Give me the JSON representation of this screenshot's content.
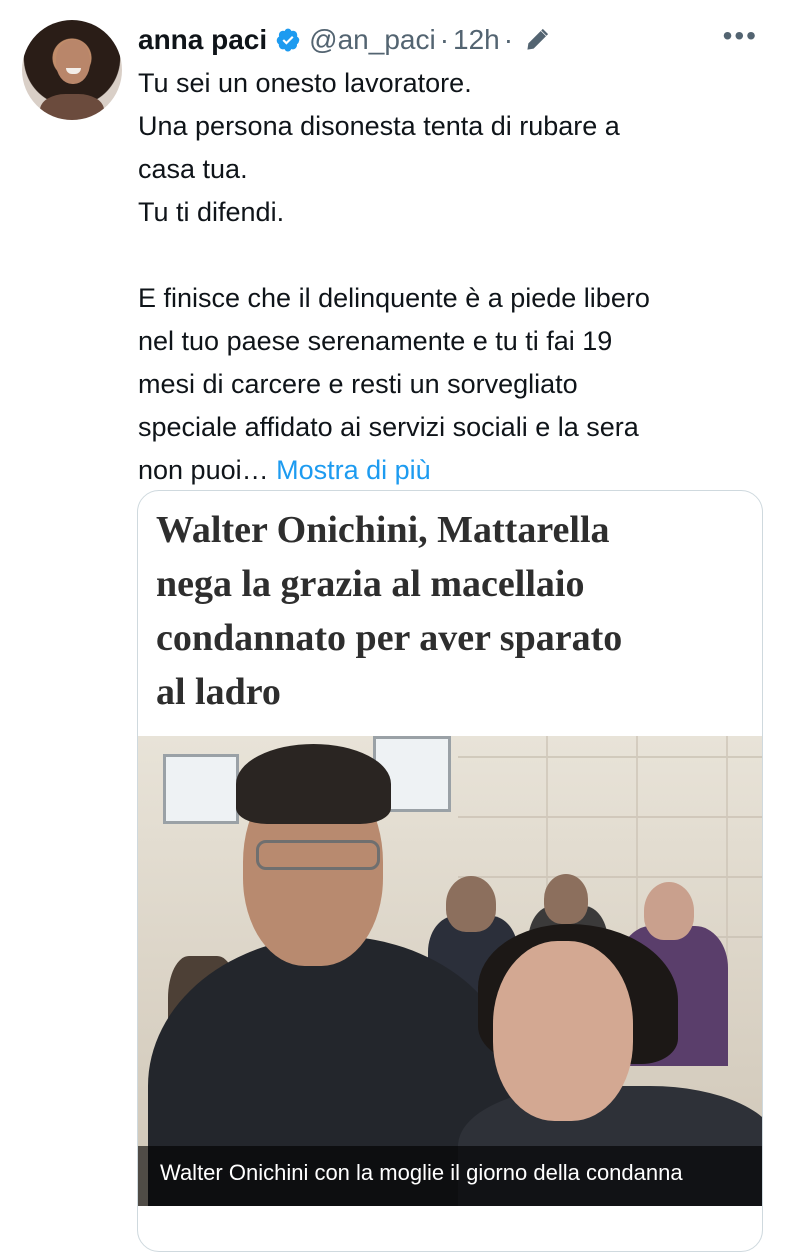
{
  "tweet": {
    "author_name": "anna paci",
    "handle": "@an_paci",
    "separator": "·",
    "time": "12h",
    "icons": {
      "avatar": "profile-photo",
      "verified": "verified-badge-icon",
      "edit": "pen-icon",
      "more": "more-icon"
    },
    "text_lines": [
      "Tu sei un onesto lavoratore.",
      "Una persona disonesta tenta di rubare a",
      "casa tua.",
      "Tu ti difendi.",
      "",
      "E finisce che il delinquente è a piede libero",
      "nel tuo paese serenamente e tu ti fai 19",
      "mesi di carcere e resti un sorvegliato",
      "speciale affidato ai servizi sociali e la sera",
      "non puoi…"
    ],
    "show_more": "Mostra di più"
  },
  "card": {
    "headline_lines": [
      "Walter Onichini, Mattarella",
      "nega la grazia al macellaio",
      "condannato per aver sparato",
      "al ladro"
    ],
    "image_caption": "Walter Onichini con la moglie il giorno della condanna"
  },
  "colors": {
    "text": "#0f1419",
    "secondary": "#536471",
    "link": "#1d9bf0",
    "verified": "#1d9bf0",
    "headline": "#2e2e2e"
  }
}
